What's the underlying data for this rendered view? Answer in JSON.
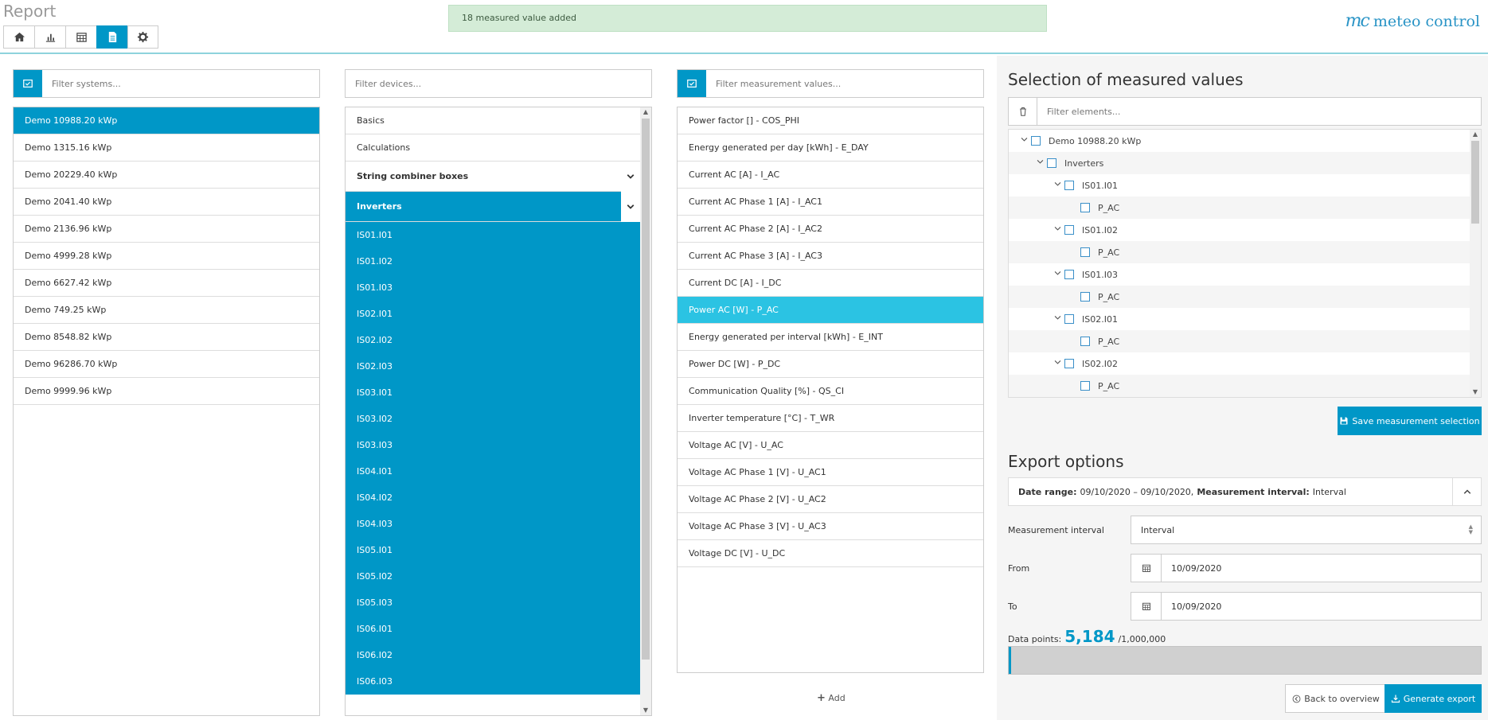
{
  "app": {
    "title": "Report"
  },
  "toolbar": {
    "buttons": [
      {
        "icon": "home-icon"
      },
      {
        "icon": "chart-icon"
      },
      {
        "icon": "calendar-icon"
      },
      {
        "icon": "report-icon",
        "active": true
      },
      {
        "icon": "gear-icon"
      }
    ]
  },
  "toast": {
    "message": "18 measured value added"
  },
  "logo": {
    "mark": "mc",
    "text": "meteo control"
  },
  "systems": {
    "filter_placeholder": "Filter systems...",
    "items": [
      "Demo 10988.20 kWp",
      "Demo 1315.16 kWp",
      "Demo 20229.40 kWp",
      "Demo 2041.40 kWp",
      "Demo 2136.96 kWp",
      "Demo 4999.28 kWp",
      "Demo 6627.42 kWp",
      "Demo 749.25 kWp",
      "Demo 8548.82 kWp",
      "Demo 96286.70 kWp",
      "Demo 9999.96 kWp"
    ],
    "selected": "Demo 10988.20 kWp"
  },
  "devices": {
    "filter_placeholder": "Filter devices...",
    "groups": [
      "Basics",
      "Calculations",
      "String combiner boxes",
      "Inverters"
    ],
    "inverters": [
      "IS01.I01",
      "IS01.I02",
      "IS01.I03",
      "IS02.I01",
      "IS02.I02",
      "IS02.I03",
      "IS03.I01",
      "IS03.I02",
      "IS03.I03",
      "IS04.I01",
      "IS04.I02",
      "IS04.I03",
      "IS05.I01",
      "IS05.I02",
      "IS05.I03",
      "IS06.I01",
      "IS06.I02",
      "IS06.I03"
    ]
  },
  "measurements": {
    "filter_placeholder": "Filter measurement values...",
    "items": [
      "Power factor [] - COS_PHI",
      "Energy generated per day [kWh] - E_DAY",
      "Current AC [A] - I_AC",
      "Current AC Phase 1 [A] - I_AC1",
      "Current AC Phase 2 [A] - I_AC2",
      "Current AC Phase 3 [A] - I_AC3",
      "Current DC [A] - I_DC",
      "Power AC [W] - P_AC",
      "Energy generated per interval [kWh] - E_INT",
      "Power DC [W] - P_DC",
      "Communication Quality [%] - QS_CI",
      "Inverter temperature [°C] - T_WR",
      "Voltage AC [V] - U_AC",
      "Voltage AC Phase 1 [V] - U_AC1",
      "Voltage AC Phase 2 [V] - U_AC2",
      "Voltage AC Phase 3 [V] - U_AC3",
      "Voltage DC [V] - U_DC"
    ],
    "hovered": "Power AC [W] - P_AC",
    "add_label": "Add"
  },
  "selection": {
    "title": "Selection of measured values",
    "filter_placeholder": "Filter elements...",
    "tree": {
      "root": "Demo 10988.20 kWp",
      "group": "Inverters",
      "devices": [
        {
          "name": "IS01.I01",
          "value": "P_AC"
        },
        {
          "name": "IS01.I02",
          "value": "P_AC"
        },
        {
          "name": "IS01.I03",
          "value": "P_AC"
        },
        {
          "name": "IS02.I01",
          "value": "P_AC"
        },
        {
          "name": "IS02.I02",
          "value": "P_AC"
        }
      ]
    },
    "save_label": "Save measurement selection"
  },
  "export": {
    "title": "Export options",
    "date_range_label": "Date range:",
    "date_range_value": "09/10/2020 – 09/10/2020,",
    "interval_label": "Measurement interval:",
    "interval_value_summary": "Interval",
    "measurement_interval_label": "Measurement interval",
    "measurement_interval_value": "Interval",
    "from_label": "From",
    "from_value": "10/09/2020",
    "to_label": "To",
    "to_value": "10/09/2020",
    "data_points_label": "Data points:",
    "data_points_value": "5,184",
    "data_points_max": "/1,000,000",
    "data_points_fraction": 0.005184,
    "back_label": "Back to overview",
    "generate_label": "Generate export"
  },
  "colors": {
    "accent": "#0097c7",
    "hover": "#2bc3e3",
    "toast_bg": "#d4ecd7"
  }
}
